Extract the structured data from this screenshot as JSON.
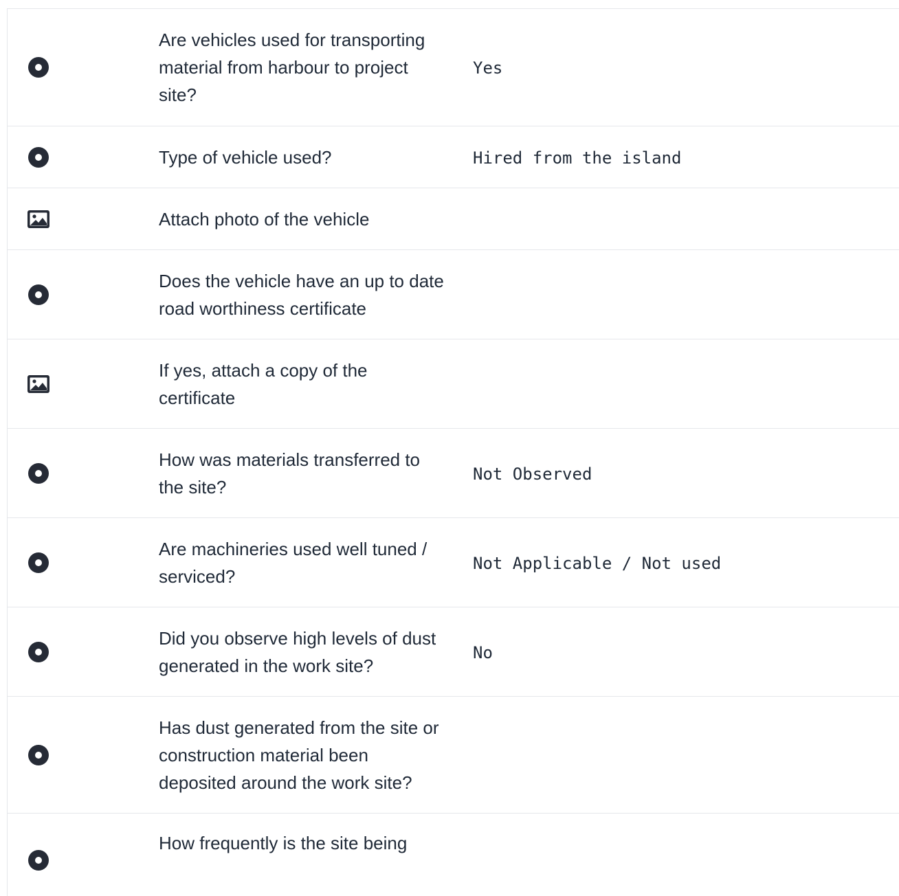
{
  "rows": [
    {
      "icon": "radio-icon",
      "question": "Are vehicles used for transporting material from harbour to project site?",
      "answer": "Yes"
    },
    {
      "icon": "radio-icon",
      "question": "Type of vehicle used?",
      "answer": "Hired from the island"
    },
    {
      "icon": "image-icon",
      "question": "Attach photo of the vehicle",
      "answer": ""
    },
    {
      "icon": "radio-icon",
      "question": "Does the vehicle have an up to date road worthiness certificate",
      "answer": ""
    },
    {
      "icon": "image-icon",
      "question": "If yes, attach a copy of the certificate",
      "answer": ""
    },
    {
      "icon": "radio-icon",
      "question": "How was materials transferred to the site?",
      "answer": "Not Observed"
    },
    {
      "icon": "radio-icon",
      "question": "Are machineries used well tuned / serviced?",
      "answer": "Not Applicable / Not used"
    },
    {
      "icon": "radio-icon",
      "question": "Did you observe high levels of dust generated in the work site?",
      "answer": "No"
    },
    {
      "icon": "radio-icon",
      "question": "Has dust generated from the site or construction material been deposited around the work site?",
      "answer": ""
    },
    {
      "icon": "radio-icon",
      "question": "How frequently is the site being",
      "answer": ""
    }
  ]
}
